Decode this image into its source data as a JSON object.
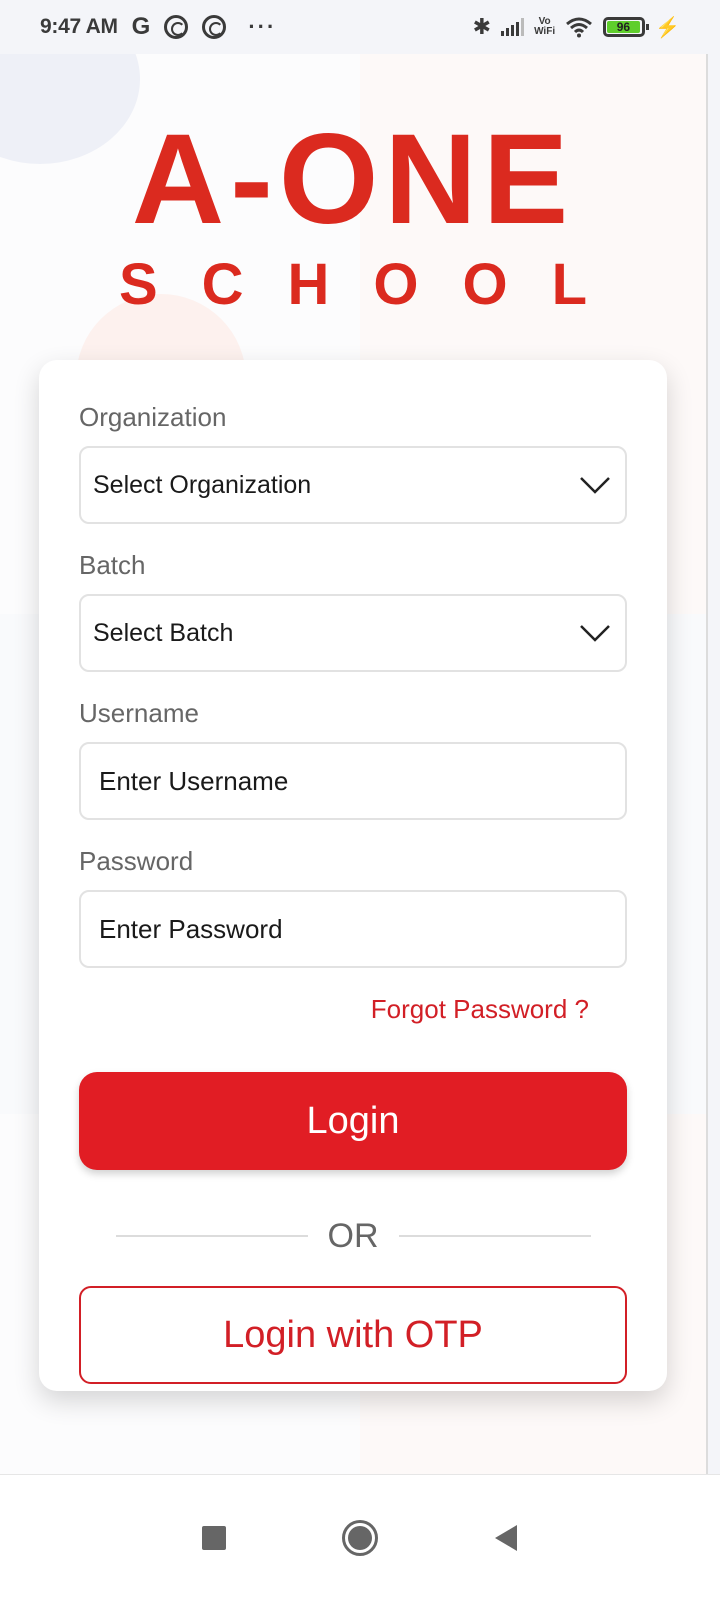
{
  "status_bar": {
    "time": "9:47 AM",
    "left_icons": [
      "google-icon",
      "hotspot-icon",
      "hotspot-icon",
      "more-notifications-icon"
    ],
    "vowifi_top": "Vo",
    "vowifi_bottom": "WiFi",
    "battery_level": "96",
    "battery_percent": 96,
    "charging": true
  },
  "logo": {
    "title": "A-ONE",
    "subtitle": "SCHOOL",
    "color": "#db2a1f"
  },
  "form": {
    "organization": {
      "label": "Organization",
      "value": "Select Organization"
    },
    "batch": {
      "label": "Batch",
      "value": "Select Batch"
    },
    "username": {
      "label": "Username",
      "placeholder": "Enter Username"
    },
    "password": {
      "label": "Password",
      "placeholder": "Enter Password"
    },
    "forgot_password": "Forgot Password ?",
    "login_button": "Login",
    "divider_text": "OR",
    "otp_button": "Login with OTP"
  },
  "colors": {
    "primary": "#e11d24",
    "link": "#d21f26",
    "label": "#666666"
  },
  "nav_bar": {
    "buttons": [
      "recents",
      "home",
      "back"
    ]
  }
}
